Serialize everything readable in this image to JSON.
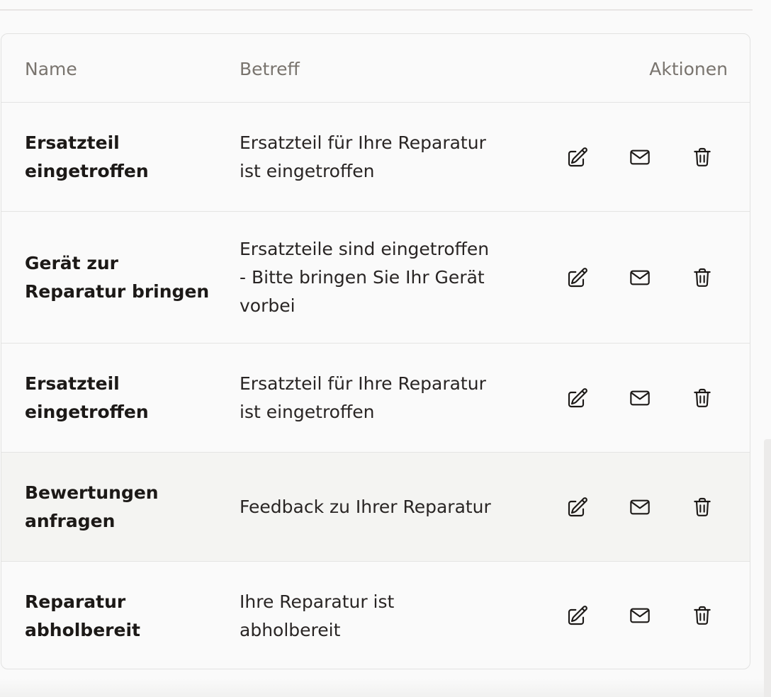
{
  "table": {
    "headers": {
      "name": "Name",
      "subject": "Betreff",
      "actions": "Aktionen"
    },
    "rows": [
      {
        "name_lines": [
          "Ersatzteil",
          "eingetroffen"
        ],
        "subject_lines": [
          "Ersatzteil für Ihre Reparatur",
          "ist eingetroffen"
        ]
      },
      {
        "name_lines": [
          "Gerät zur",
          "Reparatur bringen"
        ],
        "subject_lines": [
          "Ersatzteile sind eingetroffen",
          "- Bitte bringen Sie Ihr Gerät",
          "vorbei"
        ]
      },
      {
        "name_lines": [
          "Ersatzteil",
          "eingetroffen"
        ],
        "subject_lines": [
          "Ersatzteil für Ihre Reparatur",
          "ist eingetroffen"
        ]
      },
      {
        "name_lines": [
          "Bewertungen",
          "anfragen"
        ],
        "subject_lines": [
          "Feedback zu Ihrer Reparatur"
        ]
      },
      {
        "name_lines": [
          "Reparatur",
          "abholbereit"
        ],
        "subject_lines": [
          "Ihre Reparatur ist",
          "abholbereit"
        ]
      }
    ],
    "row_actions": {
      "edit_icon": "pencil-square-icon",
      "email_icon": "envelope-icon",
      "delete_icon": "trash-icon"
    },
    "hovered_row_index": 3
  },
  "colors": {
    "text": "#1c1917",
    "header_text": "#79746e",
    "border": "#e4e4e3",
    "hover_bg": "#f4f4f2",
    "page_bg": "#fafafa"
  }
}
